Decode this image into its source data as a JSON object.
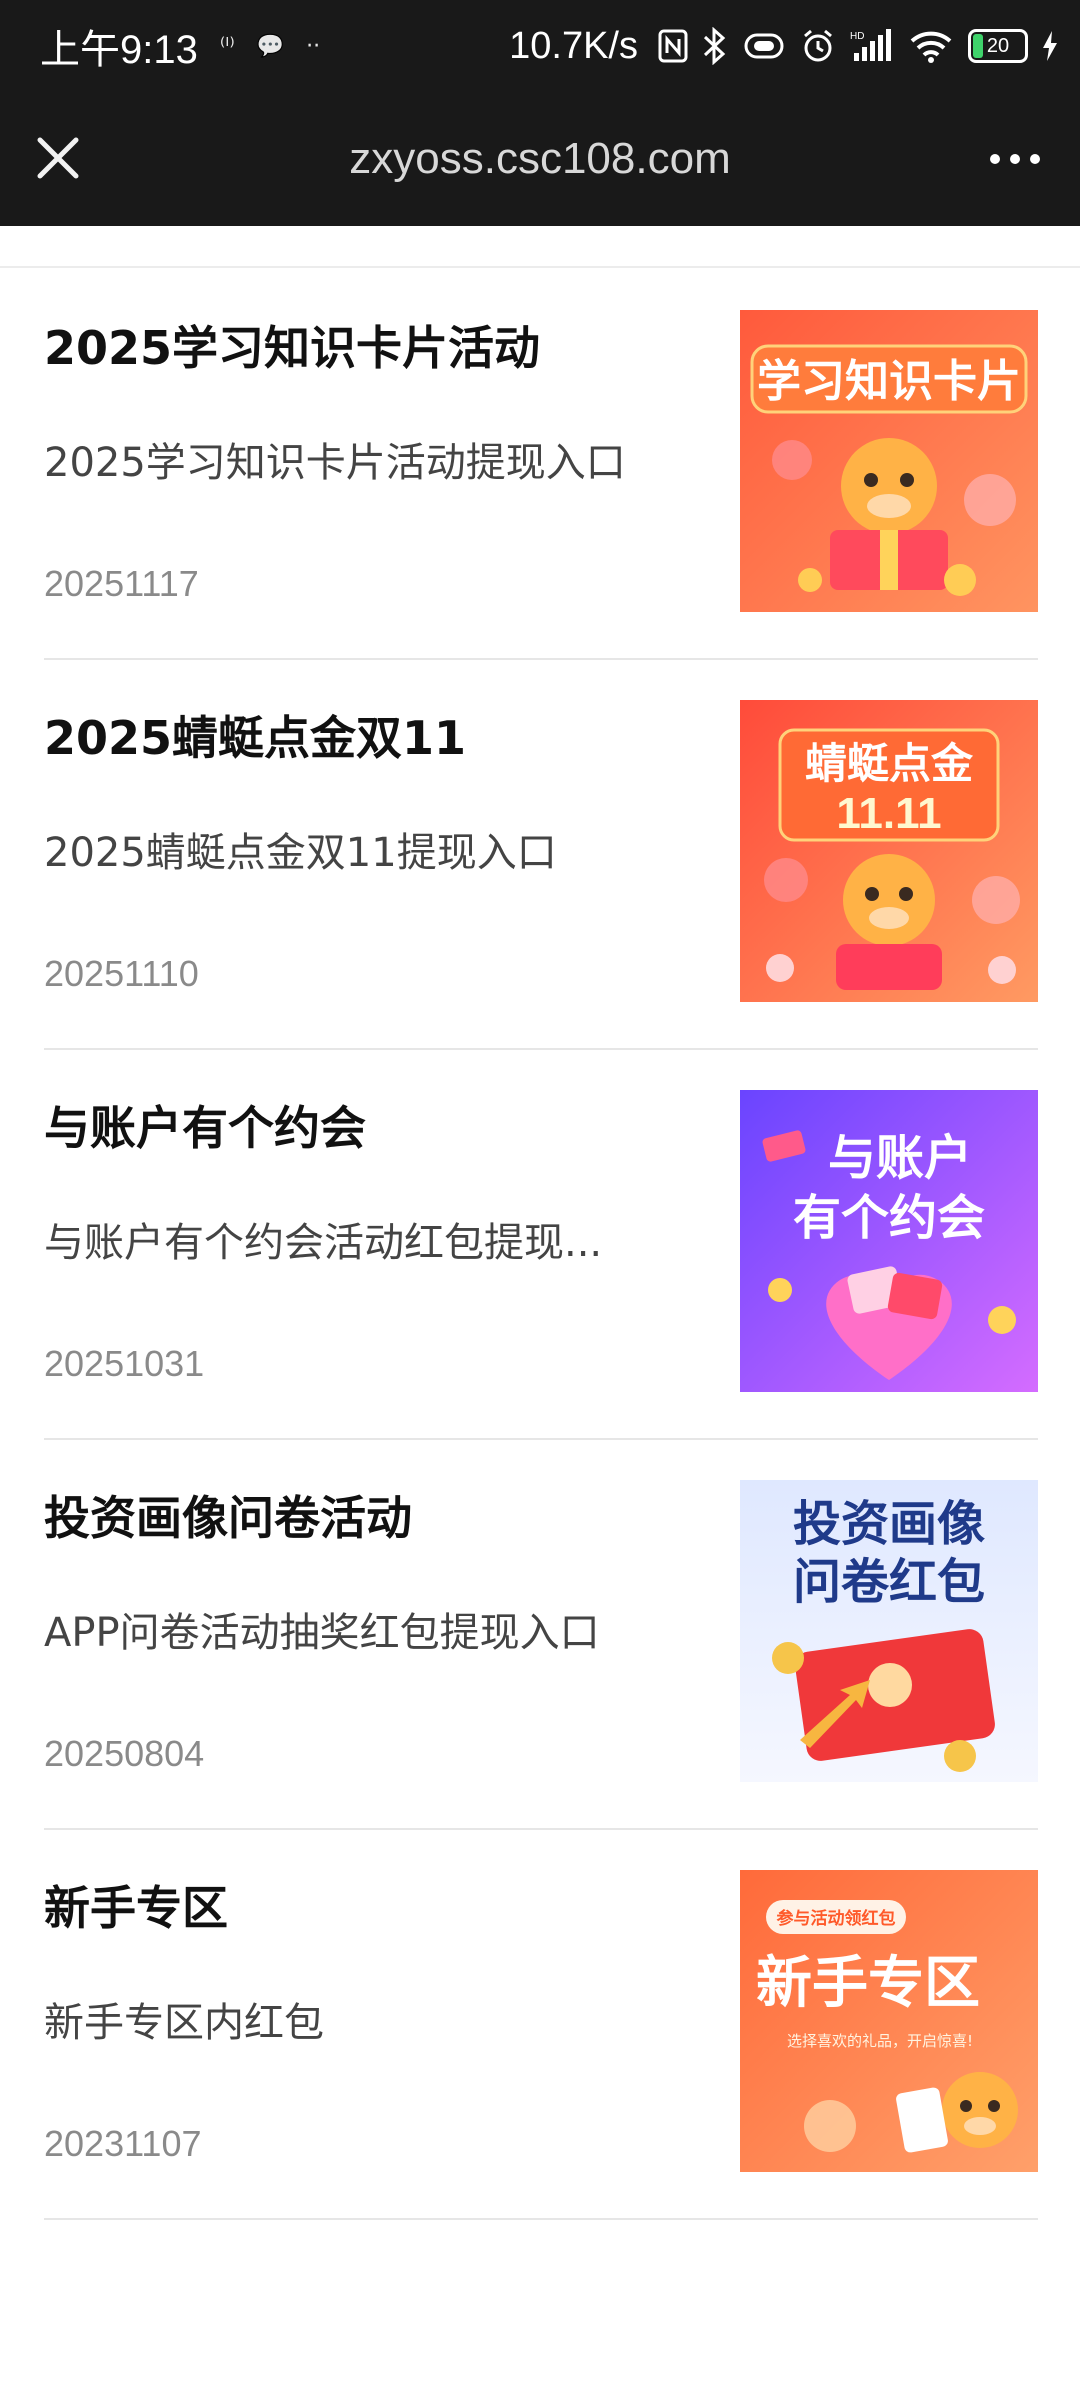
{
  "status_bar": {
    "time": "上午9:13",
    "icon_a": "⁽ᴵ⁾",
    "icon_b": "💬",
    "dots": "··",
    "speed": "10.7K/s",
    "battery": "20"
  },
  "browser": {
    "domain": "zxyoss.csc108.com"
  },
  "items": [
    {
      "title": "2025学习知识卡片活动",
      "desc": "2025学习知识卡片活动提现入口",
      "date": "20251117",
      "thumb_text": [
        "学习知识卡片"
      ],
      "colors": [
        "#ff5a3c",
        "#ff8a4a"
      ]
    },
    {
      "title": "2025蜻蜓点金双11",
      "desc": "2025蜻蜓点金双11提现入口",
      "date": "20251110",
      "thumb_text": [
        "蜻蜓点金",
        "11.11"
      ],
      "colors": [
        "#ff4b3a",
        "#ff8e52"
      ]
    },
    {
      "title": "与账户有个约会",
      "desc": "与账户有个约会活动红包提现...",
      "date": "20251031",
      "thumb_text": [
        "与账户",
        "有个约会"
      ],
      "colors": [
        "#7a4cff",
        "#c66cff"
      ]
    },
    {
      "title": "投资画像问卷活动",
      "desc": "APP问卷活动抽奖红包提现入口",
      "date": "20250804",
      "thumb_text": [
        "投资画像",
        "问卷红包"
      ],
      "colors": [
        "#dfe9ff",
        "#f3f6ff"
      ]
    },
    {
      "title": "新手专区",
      "desc": "新手专区内红包",
      "date": "20231107",
      "thumb_text": [
        "参与活动领红包",
        "新手专区",
        "选择喜欢的礼品，开启惊喜!"
      ],
      "colors": [
        "#ff6a3a",
        "#ff9a5a"
      ]
    }
  ]
}
